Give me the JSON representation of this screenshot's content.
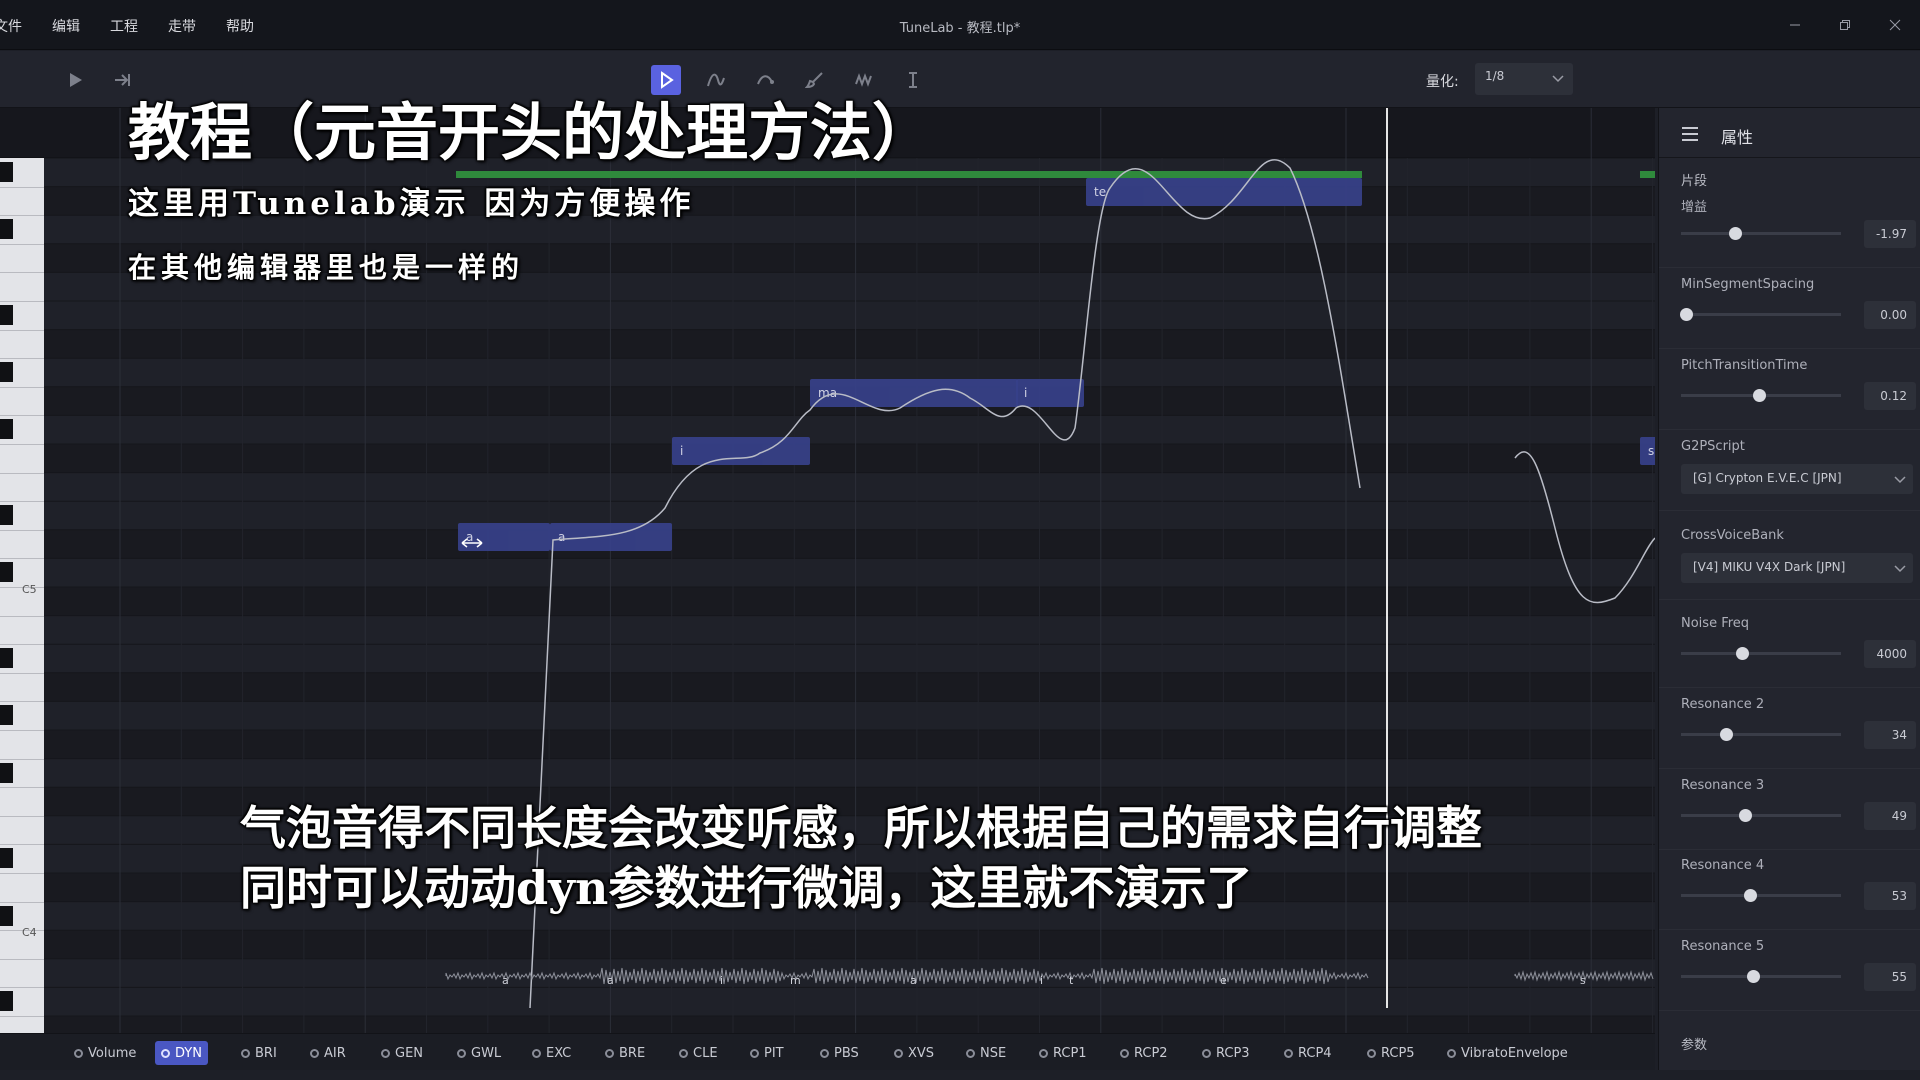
{
  "app": {
    "window_title": "TuneLab - 教程.tlp*",
    "menu": [
      "文件",
      "编辑",
      "工程",
      "走带",
      "帮助"
    ]
  },
  "toolbar": {
    "quantize_label": "量化:",
    "quantize_value": "1/8"
  },
  "piano": {
    "labels": [
      "C5",
      "C4"
    ]
  },
  "notes": [
    {
      "lyric": "a"
    },
    {
      "lyric": "a"
    },
    {
      "lyric": "i"
    },
    {
      "lyric": "ma"
    },
    {
      "lyric": "i"
    },
    {
      "lyric": "te"
    },
    {
      "lyric": "s"
    }
  ],
  "phonemes": [
    "a",
    "a",
    "i",
    "m",
    "a",
    "i",
    "t",
    "e",
    "s"
  ],
  "param_tabs": [
    {
      "label": "Volume",
      "active": false
    },
    {
      "label": "DYN",
      "active": true
    },
    {
      "label": "BRI",
      "active": false
    },
    {
      "label": "AIR",
      "active": false
    },
    {
      "label": "GEN",
      "active": false
    },
    {
      "label": "GWL",
      "active": false
    },
    {
      "label": "EXC",
      "active": false
    },
    {
      "label": "BRE",
      "active": false
    },
    {
      "label": "CLE",
      "active": false
    },
    {
      "label": "PIT",
      "active": false
    },
    {
      "label": "PBS",
      "active": false
    },
    {
      "label": "XVS",
      "active": false
    },
    {
      "label": "NSE",
      "active": false
    },
    {
      "label": "RCP1",
      "active": false
    },
    {
      "label": "RCP2",
      "active": false
    },
    {
      "label": "RCP3",
      "active": false
    },
    {
      "label": "RCP4",
      "active": false
    },
    {
      "label": "RCP5",
      "active": false
    },
    {
      "label": "VibratoEnvelope",
      "active": false
    }
  ],
  "properties": {
    "title": "属性",
    "section_segment": "片段",
    "section_params": "参数",
    "gain": {
      "label": "增益",
      "value": "-1.97",
      "level": 0.34
    },
    "min_segment_spacing": {
      "label": "MinSegmentSpacing",
      "value": "0.00",
      "level": 0.03
    },
    "pitch_transition_time": {
      "label": "PitchTransitionTime",
      "value": "0.12",
      "level": 0.49
    },
    "g2p_script": {
      "label": "G2PScript",
      "value": "[G] Crypton E.V.E.C [JPN]"
    },
    "cross_voice_bank": {
      "label": "CrossVoiceBank",
      "value": "[V4] MIKU V4X Dark [JPN]"
    },
    "noise_freq": {
      "label": "Noise Freq",
      "value": "4000",
      "level": 0.38
    },
    "resonance_2": {
      "label": "Resonance 2",
      "value": "34",
      "level": 0.28
    },
    "resonance_3": {
      "label": "Resonance 3",
      "value": "49",
      "level": 0.4
    },
    "resonance_4": {
      "label": "Resonance 4",
      "value": "53",
      "level": 0.43
    },
    "resonance_5": {
      "label": "Resonance 5",
      "value": "55",
      "level": 0.45
    }
  },
  "captions": {
    "title": "教程（元音开头的处理方法）",
    "line1": "这里用Tunelab演示  因为方便操作",
    "line2": "在其他编辑器里也是一样的",
    "bottom1": "气泡音得不同长度会改变听感，所以根据自己的需求自行调整",
    "bottom2": "同时可以动动dyn参数进行微调，这里就不演示了"
  },
  "colors": {
    "accent": "#5a62e0",
    "note_fill": "#37418a",
    "segment_bar": "#2f8a3c"
  }
}
